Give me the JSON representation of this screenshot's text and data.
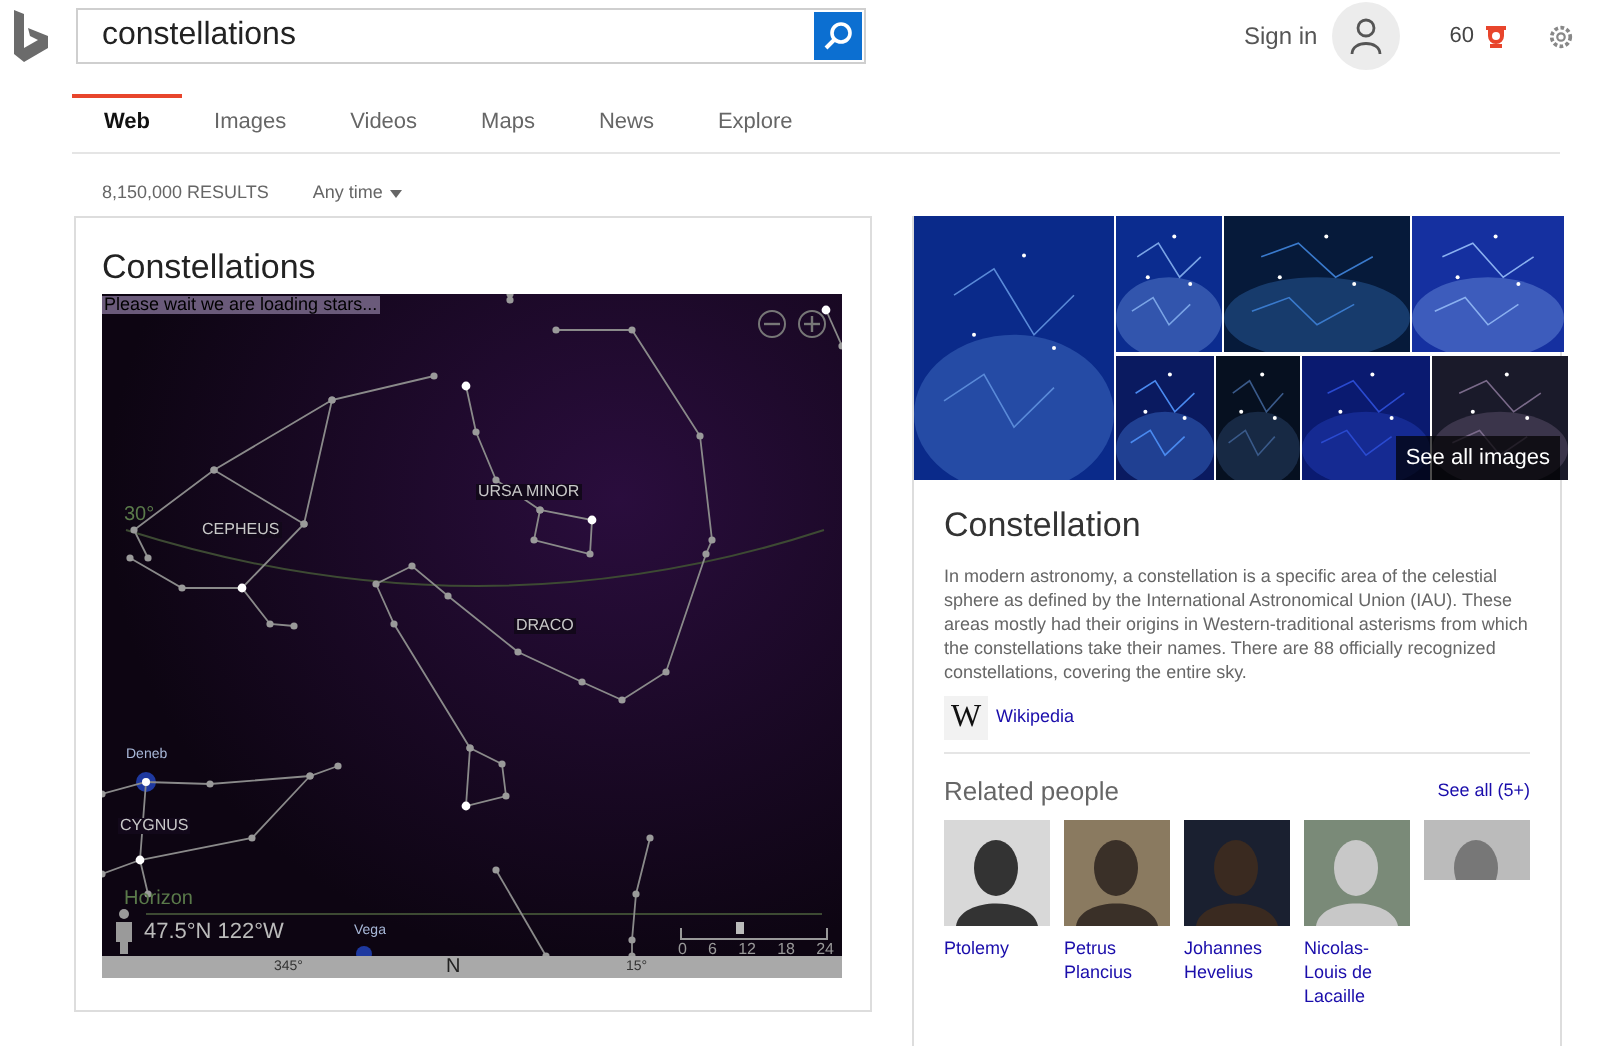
{
  "header": {
    "search": {
      "value": "constellations"
    },
    "sign_in": "Sign in",
    "rewards": "60"
  },
  "tabs": [
    {
      "label": "Web",
      "selected": true
    },
    {
      "label": "Images",
      "selected": false
    },
    {
      "label": "Videos",
      "selected": false
    },
    {
      "label": "Maps",
      "selected": false
    },
    {
      "label": "News",
      "selected": false
    },
    {
      "label": "Explore",
      "selected": false
    }
  ],
  "results_count": "8,150,000 RESULTS",
  "time_filter": "Any time",
  "sky_card": {
    "title": "Constellations",
    "loading": "Please wait we are loading stars...",
    "constellations": [
      {
        "text": "URSA MINOR"
      },
      {
        "text": "CEPHEUS"
      },
      {
        "text": "DRACO"
      },
      {
        "text": "CYGNUS"
      }
    ],
    "stars": [
      {
        "name": "Deneb"
      },
      {
        "name": "Vega"
      }
    ],
    "arc_label": "30°",
    "horizon": "Horizon",
    "location": "47.5°N 122°W",
    "compass": [
      "345°",
      "N",
      "15°"
    ],
    "time_scale": {
      "ticks": [
        "0",
        "6",
        "12",
        "18",
        "24"
      ],
      "level": 0.37
    }
  },
  "knowledge": {
    "images_link": "See all images",
    "title": "Constellation",
    "description": "In modern astronomy, a constellation is a specific area of the celestial sphere as defined by the International Astronomical Union (IAU). These areas mostly had their origins in Western-traditional asterisms from which the constellations take their names. There are 88 officially recognized constellations, covering the entire sky.",
    "source_icon": "W",
    "source": "Wikipedia",
    "related_title": "Related people",
    "see_all": "See all (5+)",
    "people": [
      {
        "name": "Ptolemy"
      },
      {
        "name": "Petrus Plancius"
      },
      {
        "name": "Johannes Hevelius"
      },
      {
        "name": "Nicolas-Louis de Lacaille"
      },
      {
        "kind": "picture"
      }
    ]
  }
}
